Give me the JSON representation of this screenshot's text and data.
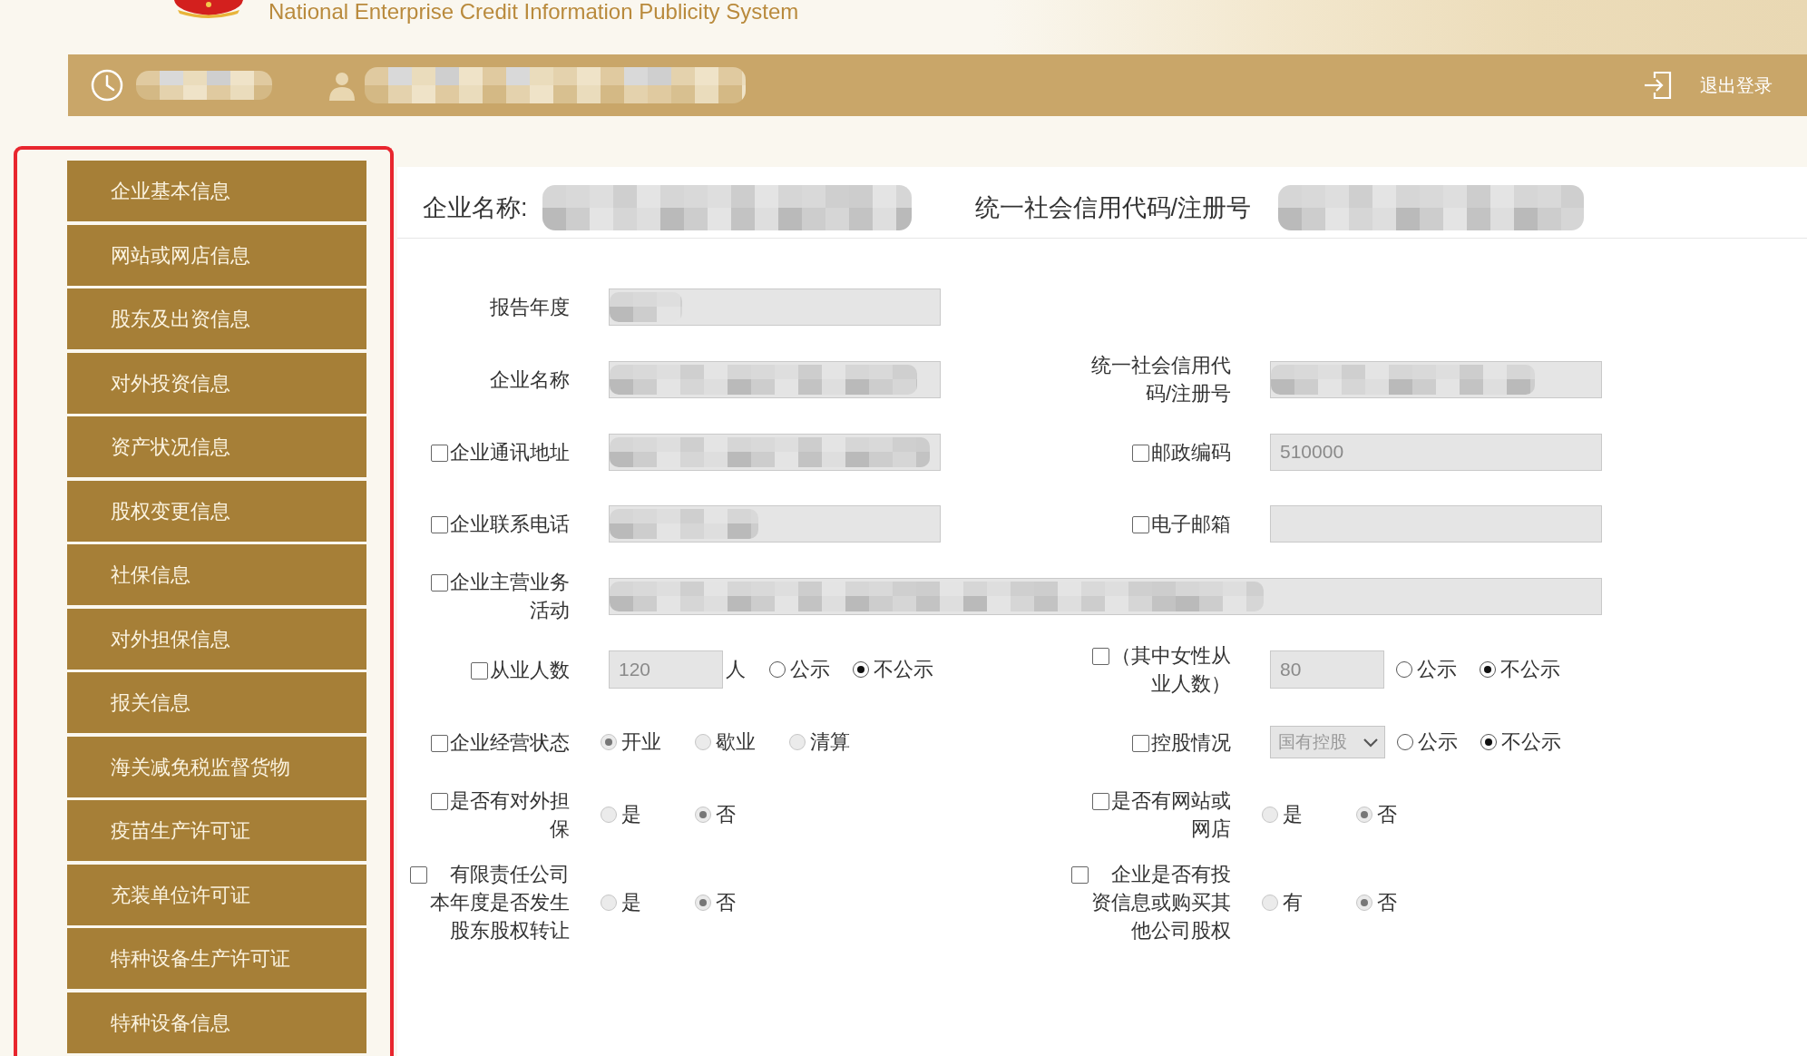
{
  "header": {
    "subtitle": "National Enterprise Credit Information Publicity System"
  },
  "toolbar": {
    "date_redacted": true,
    "user_redacted": true,
    "logout": "退出登录"
  },
  "sidebar": {
    "highlighted": true,
    "items": [
      {
        "label": "企业基本信息",
        "selected": false
      },
      {
        "label": "网站或网店信息",
        "selected": false
      },
      {
        "label": "股东及出资信息",
        "selected": false
      },
      {
        "label": "对外投资信息",
        "selected": false
      },
      {
        "label": "资产状况信息",
        "selected": false
      },
      {
        "label": "股权变更信息",
        "selected": false
      },
      {
        "label": "社保信息",
        "selected": false
      },
      {
        "label": "对外担保信息",
        "selected": false
      },
      {
        "label": "报关信息",
        "selected": false
      },
      {
        "label": "海关减免税监督货物",
        "selected": false
      },
      {
        "label": "疫苗生产许可证",
        "selected": false
      },
      {
        "label": "充装单位许可证",
        "selected": false
      },
      {
        "label": "特种设备生产许可证",
        "selected": false
      },
      {
        "label": "特种设备信息",
        "selected": false
      }
    ]
  },
  "summary": [
    {
      "label": "企业名称:",
      "redacted": true
    },
    {
      "label": "统一社会信用代码/注册号",
      "redacted": true
    }
  ],
  "form": {
    "rows": [
      {
        "cells": [
          {
            "kind": "text",
            "label": "报告年度",
            "redacted": true
          }
        ]
      },
      {
        "cells": [
          {
            "kind": "text",
            "label": "企业名称",
            "redacted": true
          },
          {
            "kind": "text",
            "label": "统一社会信用代码/注册号",
            "redacted": true
          }
        ]
      },
      {
        "cells": [
          {
            "kind": "text",
            "label": "企业通讯地址",
            "checked": false,
            "redacted": true
          },
          {
            "kind": "text",
            "label": "邮政编码",
            "checked": false,
            "value": "510000"
          }
        ]
      },
      {
        "cells": [
          {
            "kind": "text",
            "label": "企业联系电话",
            "checked": false,
            "redacted": true
          },
          {
            "kind": "text",
            "label": "电子邮箱",
            "checked": false
          }
        ]
      },
      {
        "cells": [
          {
            "kind": "longtext",
            "label": "企业主营业务活动",
            "checked": false,
            "redacted": true
          }
        ]
      },
      {
        "cells": [
          {
            "kind": "count",
            "label": "从业人数",
            "checked": false,
            "value": "120",
            "unit": "人",
            "disabled": false,
            "options": [
              {
                "label": "公示",
                "selected": false
              },
              {
                "label": "不公示",
                "selected": true
              }
            ]
          },
          {
            "kind": "count",
            "label": "（其中女性从业人数）",
            "checked": false,
            "value": "80",
            "disabled": false,
            "options": [
              {
                "label": "公示",
                "selected": false
              },
              {
                "label": "不公示",
                "selected": true
              }
            ]
          }
        ]
      },
      {
        "cells": [
          {
            "kind": "choice",
            "label": "企业经营状态",
            "checked": false,
            "disabled": true,
            "options": [
              {
                "label": "开业",
                "selected": true
              },
              {
                "label": "歇业",
                "selected": false
              },
              {
                "label": "清算",
                "selected": false
              }
            ]
          },
          {
            "kind": "select",
            "label": "控股情况",
            "checked": false,
            "value": "国有控股",
            "disabled": false,
            "options": [
              {
                "label": "公示",
                "selected": false
              },
              {
                "label": "不公示",
                "selected": true
              }
            ]
          }
        ]
      },
      {
        "cells": [
          {
            "kind": "choice",
            "label": "是否有对外担保",
            "checked": false,
            "disabled": true,
            "options": [
              {
                "label": "是",
                "selected": false
              },
              {
                "label": "否",
                "selected": true
              }
            ]
          },
          {
            "kind": "choice",
            "label": "是否有网站或网店",
            "checked": false,
            "disabled": true,
            "options": [
              {
                "label": "是",
                "selected": false
              },
              {
                "label": "否",
                "selected": true
              }
            ]
          }
        ]
      },
      {
        "cells": [
          {
            "kind": "choice",
            "label": "有限责任公司本年度是否发生股东股权转让",
            "checked": false,
            "disabled": true,
            "options": [
              {
                "label": "是",
                "selected": false
              },
              {
                "label": "否",
                "selected": true
              }
            ]
          },
          {
            "kind": "choice",
            "label": "企业是否有投资信息或购买其他公司股权",
            "checked": false,
            "disabled": true,
            "options": [
              {
                "label": "有",
                "selected": false
              },
              {
                "label": "否",
                "selected": true
              }
            ]
          }
        ]
      }
    ]
  }
}
